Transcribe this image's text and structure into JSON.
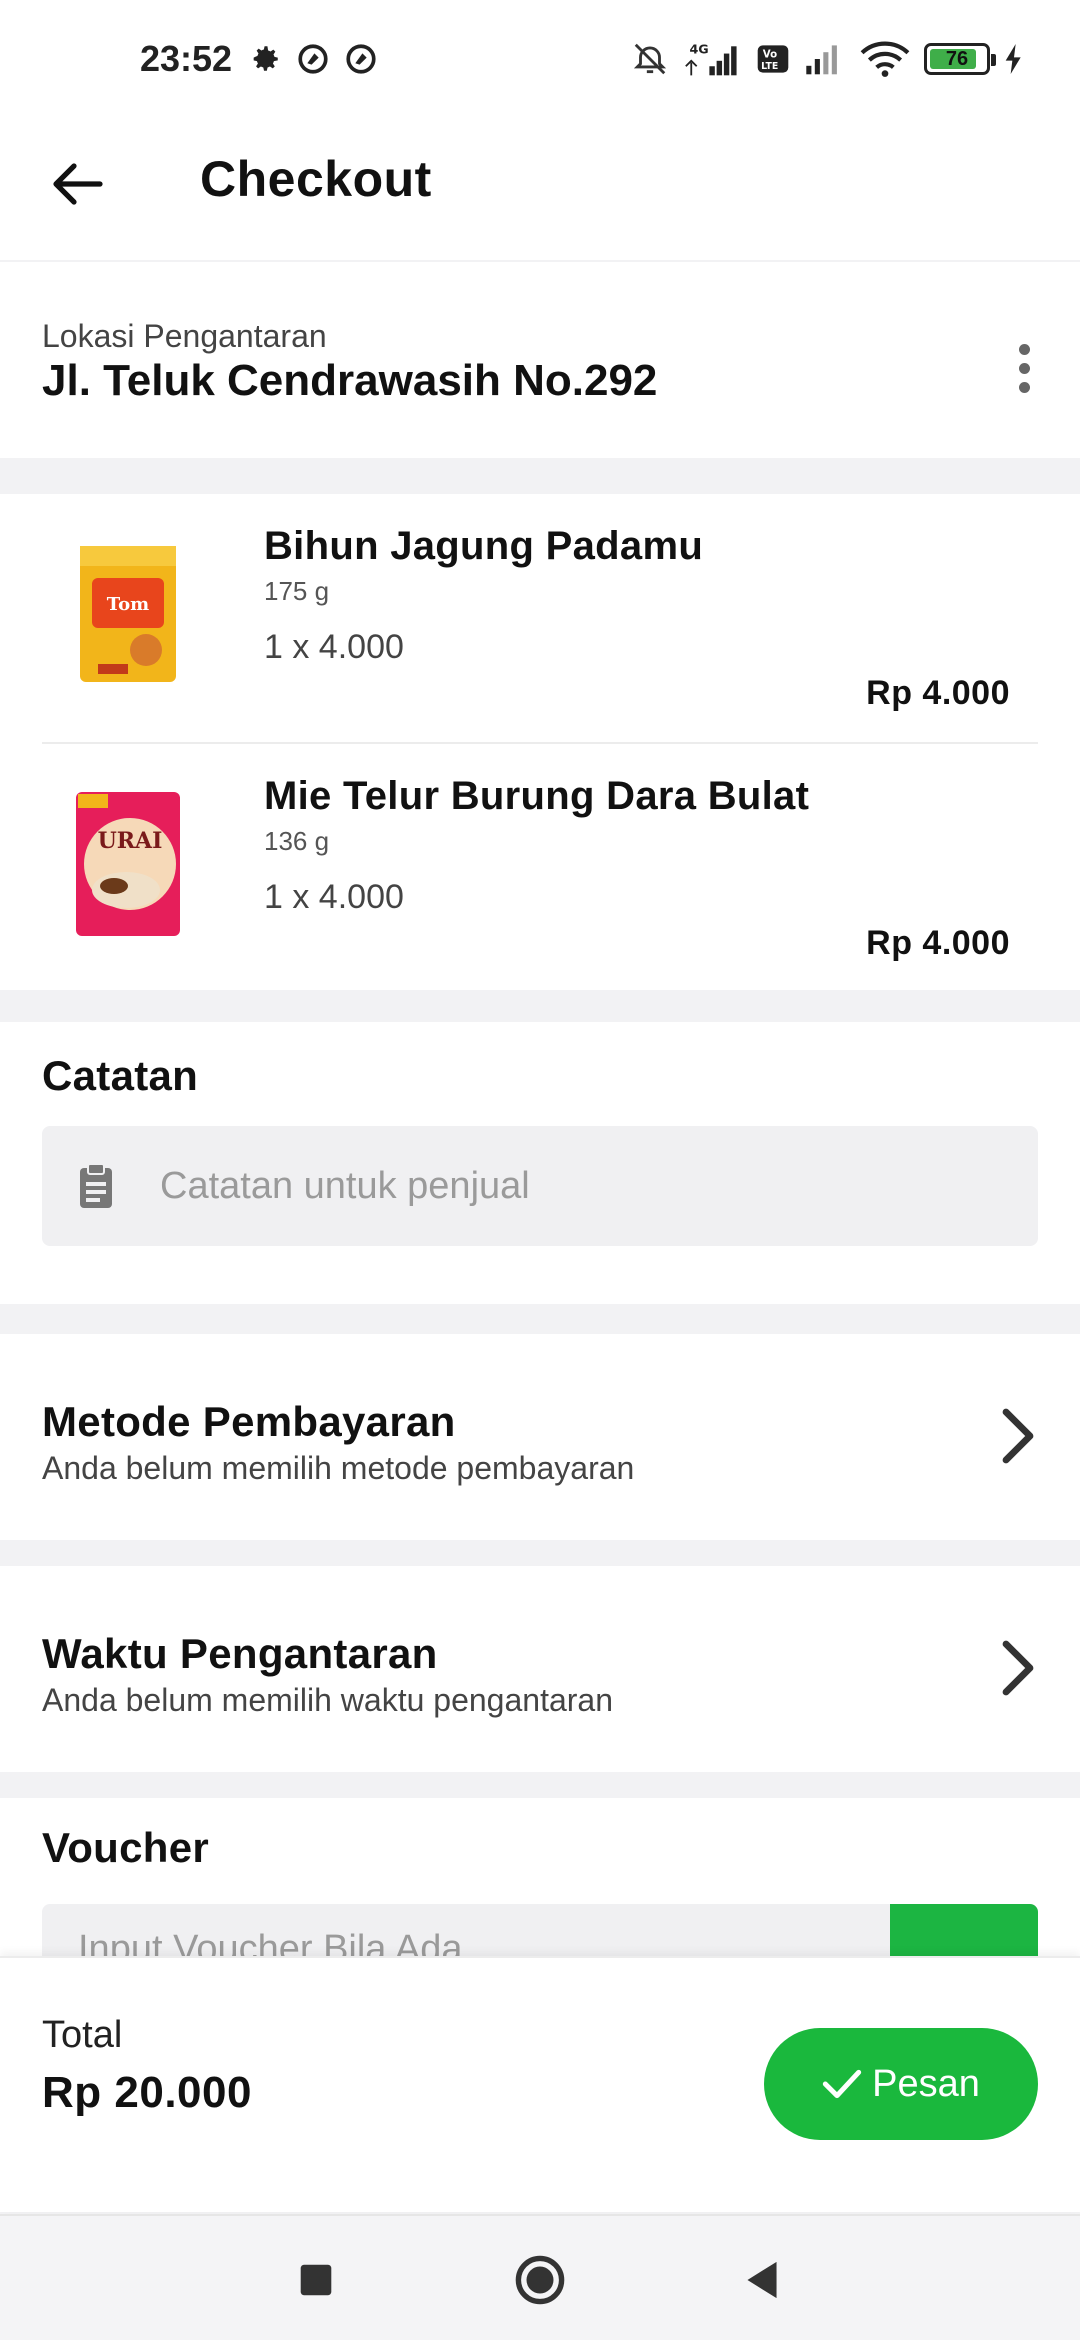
{
  "status_bar": {
    "time": "23:52",
    "battery_level": "76",
    "icons_left": [
      "settings-icon",
      "vpn-icon",
      "vpn-icon"
    ],
    "icons_right": [
      "alarm-off-icon",
      "signal-4g-icon",
      "volte-icon",
      "signal-icon",
      "wifi-icon",
      "battery-icon",
      "charging-icon"
    ]
  },
  "app_bar": {
    "title": "Checkout",
    "back_icon": "arrow-left-icon"
  },
  "delivery": {
    "label": "Lokasi Pengantaran",
    "address": "Jl. Teluk Cendrawasih No.292"
  },
  "items": [
    {
      "name": "Bihun Jagung Padamu",
      "weight": "175 g",
      "qty_price": "1 x 4.000",
      "total": "Rp 4.000"
    },
    {
      "name": "Mie Telur Burung Dara Bulat",
      "weight": "136 g",
      "qty_price": "1 x 4.000",
      "total": "Rp 4.000"
    }
  ],
  "notes": {
    "title": "Catatan",
    "placeholder": "Catatan untuk penjual",
    "value": ""
  },
  "payment": {
    "title": "Metode Pembayaran",
    "subtitle": "Anda belum memilih metode pembayaran"
  },
  "delivery_time": {
    "title": "Waktu Pengantaran",
    "subtitle": "Anda belum memilih waktu pengantaran"
  },
  "voucher": {
    "title": "Voucher",
    "placeholder": "Input Voucher Bila Ada"
  },
  "footer": {
    "total_label": "Total",
    "total_value": "Rp 20.000",
    "order_label": "Pesan"
  },
  "colors": {
    "accent_green": "#1ab83d",
    "background": "#f2f2f4"
  }
}
